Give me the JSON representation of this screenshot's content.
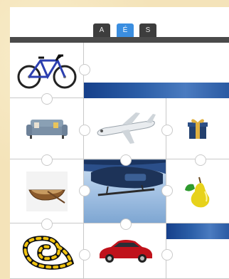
{
  "tabs": [
    {
      "label": "A"
    },
    {
      "label": "É"
    },
    {
      "label": "S"
    }
  ],
  "active_tab": "É",
  "icons": {
    "r1c1": "bicycle-icon",
    "r2c1": "sofa-icon",
    "r2c2": "airplane-icon",
    "r2c3": "gift-icon",
    "r3c1": "rowboat-icon",
    "r3c2": "helicopter-icon",
    "r3c3": "pear-icon",
    "r4c1": "snake-icon",
    "r4c2": "car-icon"
  }
}
